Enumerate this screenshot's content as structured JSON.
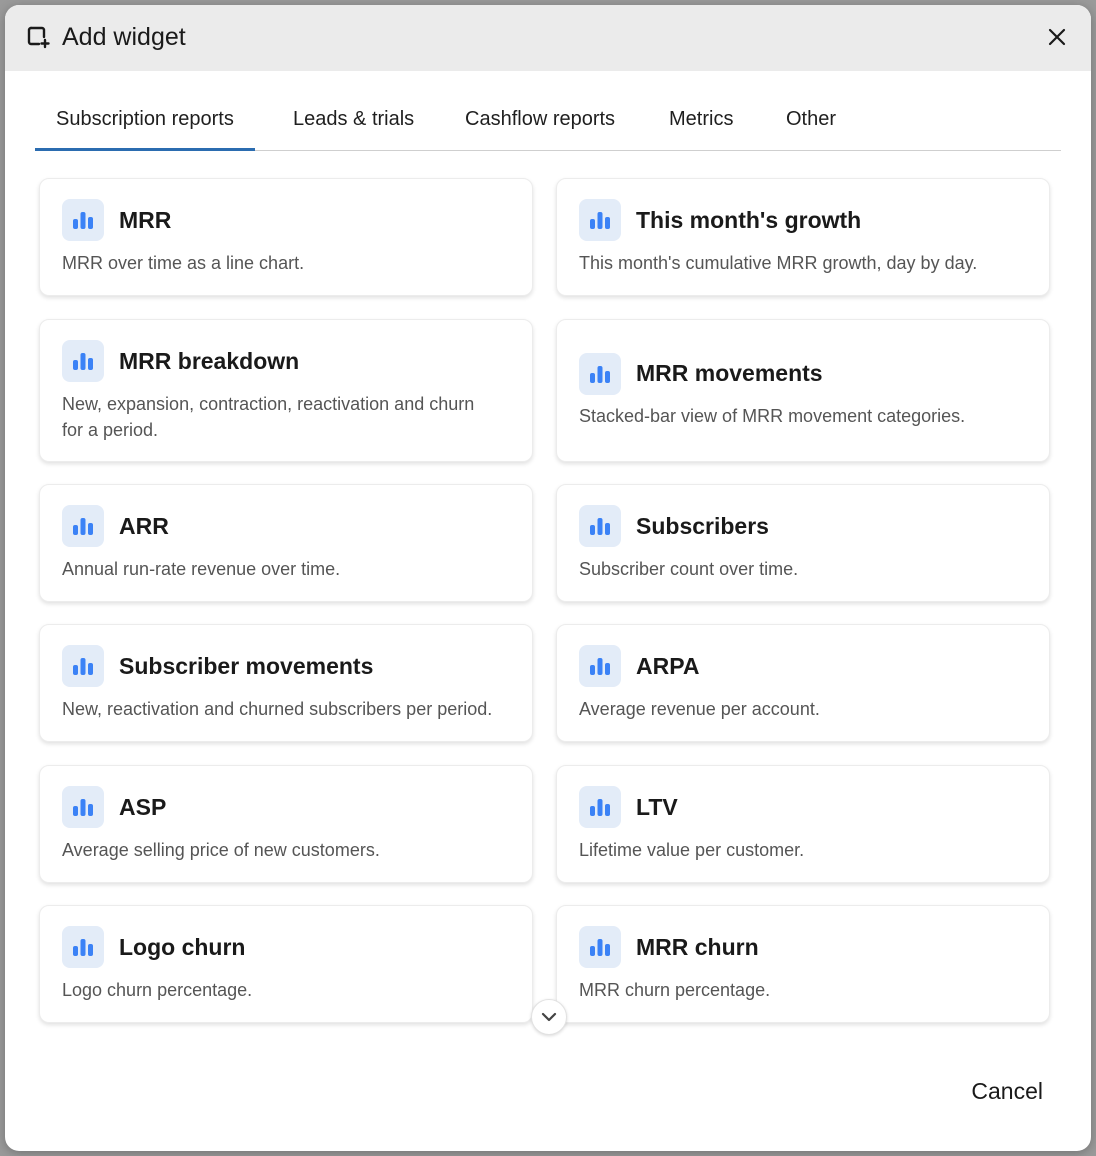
{
  "dialog": {
    "title": "Add widget",
    "title_icon": "add-widget-icon",
    "close_icon": "close-icon"
  },
  "tabs": [
    {
      "label": "Subscription reports",
      "active": true
    },
    {
      "label": "Leads & trials",
      "active": false
    },
    {
      "label": "Cashflow reports",
      "active": false
    },
    {
      "label": "Metrics",
      "active": false
    },
    {
      "label": "Other",
      "active": false
    }
  ],
  "widgets": [
    {
      "title": "MRR",
      "description": "MRR over time as a line chart.",
      "icon": "bar-chart-icon"
    },
    {
      "title": "This month's growth",
      "description": "This month's cumulative MRR growth, day by day.",
      "icon": "bar-chart-icon"
    },
    {
      "title": "MRR breakdown",
      "description": "New, expansion, contraction, reactivation and churn for a period.",
      "icon": "bar-chart-icon"
    },
    {
      "title": "MRR movements",
      "description": "Stacked-bar view of MRR movement categories.",
      "icon": "bar-chart-icon"
    },
    {
      "title": "ARR",
      "description": "Annual run-rate revenue over time.",
      "icon": "bar-chart-icon"
    },
    {
      "title": "Subscribers",
      "description": "Subscriber count over time.",
      "icon": "bar-chart-icon"
    },
    {
      "title": "Subscriber movements",
      "description": "New, reactivation and churned subscribers per period.",
      "icon": "bar-chart-icon"
    },
    {
      "title": "ARPA",
      "description": "Average revenue per account.",
      "icon": "bar-chart-icon"
    },
    {
      "title": "ASP",
      "description": "Average selling price of new customers.",
      "icon": "bar-chart-icon"
    },
    {
      "title": "LTV",
      "description": "Lifetime value per customer.",
      "icon": "bar-chart-icon"
    },
    {
      "title": "Logo churn",
      "description": "Logo churn percentage.",
      "icon": "bar-chart-icon"
    },
    {
      "title": "MRR churn",
      "description": "MRR churn percentage.",
      "icon": "bar-chart-icon"
    }
  ],
  "footer": {
    "cancel_label": "Cancel"
  },
  "colors": {
    "accent": "#2b6cb0",
    "icon_bar": "#3b82f6",
    "icon_bg": "#e3ecf8",
    "header_bg": "#ebebeb"
  }
}
